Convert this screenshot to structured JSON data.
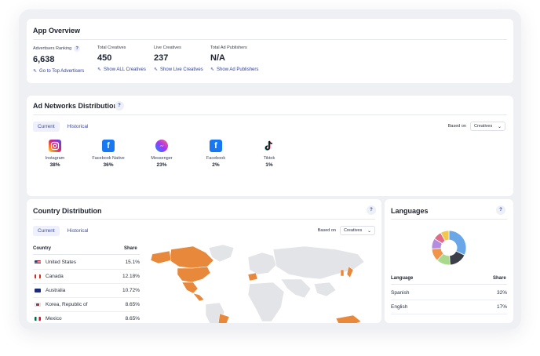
{
  "overview": {
    "title": "App Overview",
    "stats": [
      {
        "label": "Advertisers Ranking",
        "help": "?",
        "value": "6,638",
        "link": "Go to Top Advertisers"
      },
      {
        "label": "Total Creatives",
        "value": "450",
        "link": "Show ALL Creatives"
      },
      {
        "label": "Live Creatives",
        "value": "237",
        "link": "Show Live Creatives"
      },
      {
        "label": "Total Ad Publishers",
        "value": "N/A",
        "link": "Show Ad Publishers"
      }
    ],
    "link_icon": "arrow-up-left-icon"
  },
  "networks": {
    "title": "Ad Networks Distribution",
    "help": "?",
    "tabs": [
      "Current",
      "Historical"
    ],
    "based_on_label": "Based on",
    "based_on_value": "Creatives",
    "items": [
      {
        "name": "Instagram",
        "pct": "38%",
        "icon": "instagram-icon",
        "color": "#d62976"
      },
      {
        "name": "Facebook Native",
        "pct": "36%",
        "icon": "facebook-icon",
        "color": "#1877f2"
      },
      {
        "name": "Messenger",
        "pct": "23%",
        "icon": "messenger-icon",
        "color": "#8a3ffc"
      },
      {
        "name": "Facebook",
        "pct": "2%",
        "icon": "facebook-icon",
        "color": "#1877f2"
      },
      {
        "name": "Tiktok",
        "pct": "1%",
        "icon": "tiktok-icon",
        "color": "#111111"
      }
    ]
  },
  "country": {
    "title": "Country Distribution",
    "help": "?",
    "tabs": [
      "Current",
      "Historical"
    ],
    "based_on_label": "Based on",
    "based_on_value": "Creatives",
    "col_country": "Country",
    "col_share": "Share",
    "rows": [
      {
        "name": "United States",
        "share": "15.1%"
      },
      {
        "name": "Canada",
        "share": "12.18%"
      },
      {
        "name": "Australia",
        "share": "10.72%"
      },
      {
        "name": "Korea, Republic of",
        "share": "8.65%"
      },
      {
        "name": "Mexico",
        "share": "8.65%"
      }
    ],
    "highlight_color": "#e8883a"
  },
  "languages": {
    "title": "Languages",
    "help": "?",
    "col_language": "Language",
    "col_share": "Share",
    "rows": [
      {
        "name": "Spanish",
        "share": "32%"
      },
      {
        "name": "English",
        "share": "17%"
      }
    ],
    "donut": {
      "type": "pie",
      "values": [
        32,
        17,
        13,
        12,
        10,
        8,
        8
      ],
      "colors": [
        "#6aa7e8",
        "#3b3f4a",
        "#a9d98a",
        "#f0944a",
        "#b58de0",
        "#e06c8c",
        "#f1c84b"
      ]
    }
  }
}
